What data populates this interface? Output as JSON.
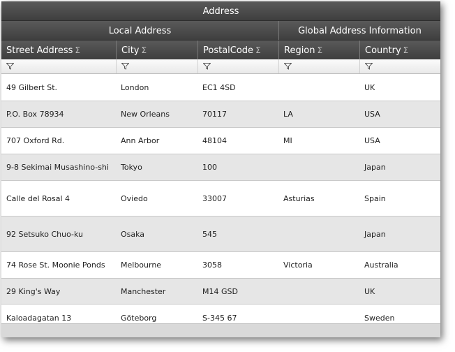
{
  "header": {
    "group_title": "Address",
    "local_group": "Local Address",
    "global_group": "Global Address Information",
    "columns": [
      "Street Address",
      "City",
      "PostalCode",
      "Region",
      "Country"
    ],
    "aggregate_symbol": "Σ"
  },
  "rows": [
    {
      "street": "49 Gilbert St.",
      "city": "London",
      "postal": "EC1 4SD",
      "region": "",
      "country": "UK"
    },
    {
      "street": "P.O. Box 78934",
      "city": "New Orleans",
      "postal": "70117",
      "region": "LA",
      "country": "USA"
    },
    {
      "street": "707 Oxford Rd.",
      "city": "Ann Arbor",
      "postal": "48104",
      "region": "MI",
      "country": "USA"
    },
    {
      "street": "9-8 Sekimai Musashino-shi",
      "city": "Tokyo",
      "postal": "100",
      "region": "",
      "country": "Japan"
    },
    {
      "street": "Calle del Rosal 4",
      "city": "Oviedo",
      "postal": "33007",
      "region": "Asturias",
      "country": "Spain"
    },
    {
      "street": "92 Setsuko Chuo-ku",
      "city": "Osaka",
      "postal": "545",
      "region": "",
      "country": "Japan"
    },
    {
      "street": "74 Rose St. Moonie Ponds",
      "city": "Melbourne",
      "postal": "3058",
      "region": "Victoria",
      "country": "Australia"
    },
    {
      "street": "29 King's Way",
      "city": "Manchester",
      "postal": "M14 GSD",
      "region": "",
      "country": "UK"
    },
    {
      "street": "Kaloadagatan 13",
      "city": "Göteborg",
      "postal": "S-345 67",
      "region": "",
      "country": "Sweden"
    }
  ]
}
